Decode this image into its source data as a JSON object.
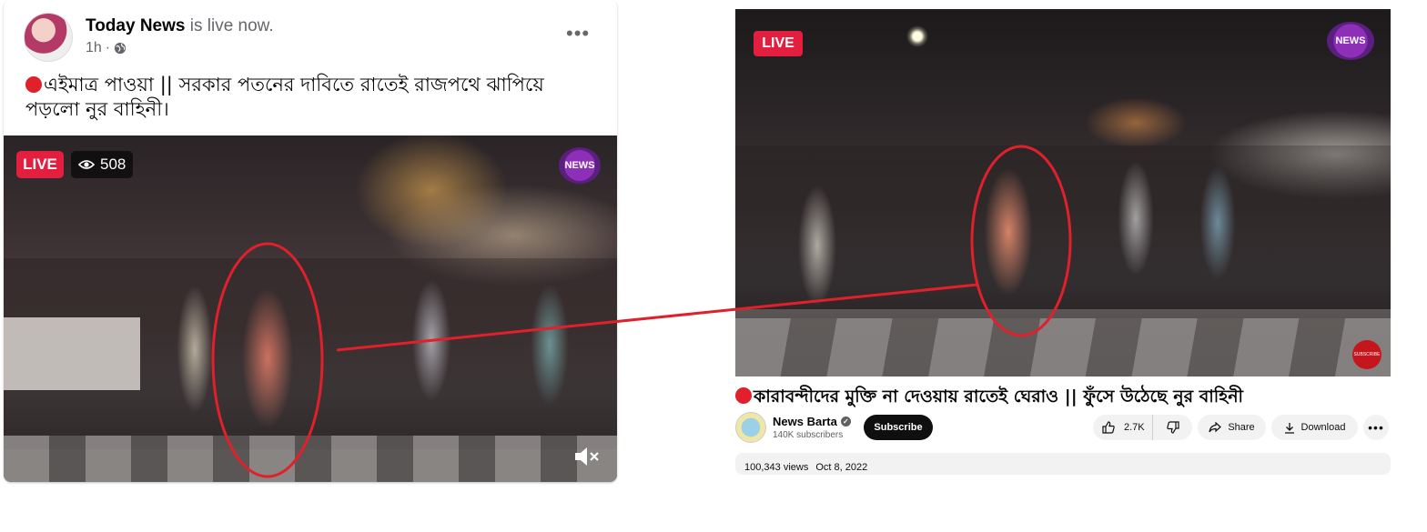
{
  "facebook_post": {
    "page_name": "Today News",
    "live_status": "is live now.",
    "time_ago": "1h",
    "more_label": "•••",
    "caption": "এইমাত্র পাওয়া || সরকার পতনের দাবিতে রাতেই রাজপথে ঝাপিয়ে পড়লো নুর বাহিনী।",
    "video": {
      "live_label": "LIVE",
      "viewer_count": "508",
      "logo_text": "NEWS"
    }
  },
  "youtube_video": {
    "live_label": "LIVE",
    "logo_text": "NEWS",
    "watermark_text": "SUBSCRIBE",
    "title": "কারাবন্দীদের মুক্তি না দেওয়ায় রাতেই ঘেরাও || ফুঁসে উঠেছে নুর বাহিনী",
    "channel_name": "News Barta",
    "subscribers": "140K subscribers",
    "subscribe_label": "Subscribe",
    "likes": "2.7K",
    "share_label": "Share",
    "download_label": "Download",
    "more_label": "•••",
    "views": "100,343 views",
    "date": "Oct 8, 2022"
  },
  "colors": {
    "live_red": "#e41e3f",
    "annotation_red": "#e0202b",
    "subscribe_black": "#0f0f0f"
  }
}
